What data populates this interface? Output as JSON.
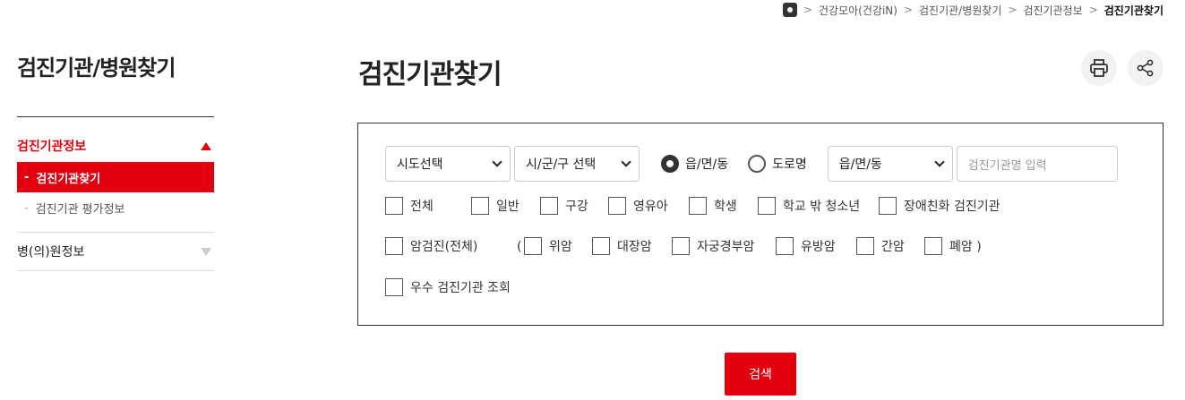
{
  "breadcrumb": {
    "items": [
      "건강모아(건강iN)",
      "검진기관/병원찾기",
      "검진기관정보",
      "검진기관찾기"
    ]
  },
  "sidebar": {
    "title": "검진기관/병원찾기",
    "groups": [
      {
        "label": "검진기관정보",
        "sub": [
          "검진기관찾기",
          "검진기관 평가정보"
        ]
      },
      {
        "label": "병(의)원정보"
      }
    ]
  },
  "main": {
    "title": "검진기관찾기"
  },
  "search": {
    "sido_select": "시도선택",
    "sigungu_select": "시/군/구 선택",
    "radio_addr1": "읍/면/동",
    "radio_addr2": "도로명",
    "dong_select": "읍/면/동",
    "name_placeholder": "검진기관명 입력",
    "checks_row1": [
      "전체",
      "일반",
      "구강",
      "영유아",
      "학생",
      "학교 밖 청소년",
      "장애친화 검진기관"
    ],
    "cancer_all": "암검진(전체)",
    "paren_open": "(",
    "checks_cancer": [
      "위암",
      "대장암",
      "자궁경부암",
      "유방암",
      "간암",
      "폐암 )"
    ],
    "excellent": "우수 검진기관 조회",
    "button": "검색"
  },
  "colors": {
    "accent": "#e2000f"
  }
}
